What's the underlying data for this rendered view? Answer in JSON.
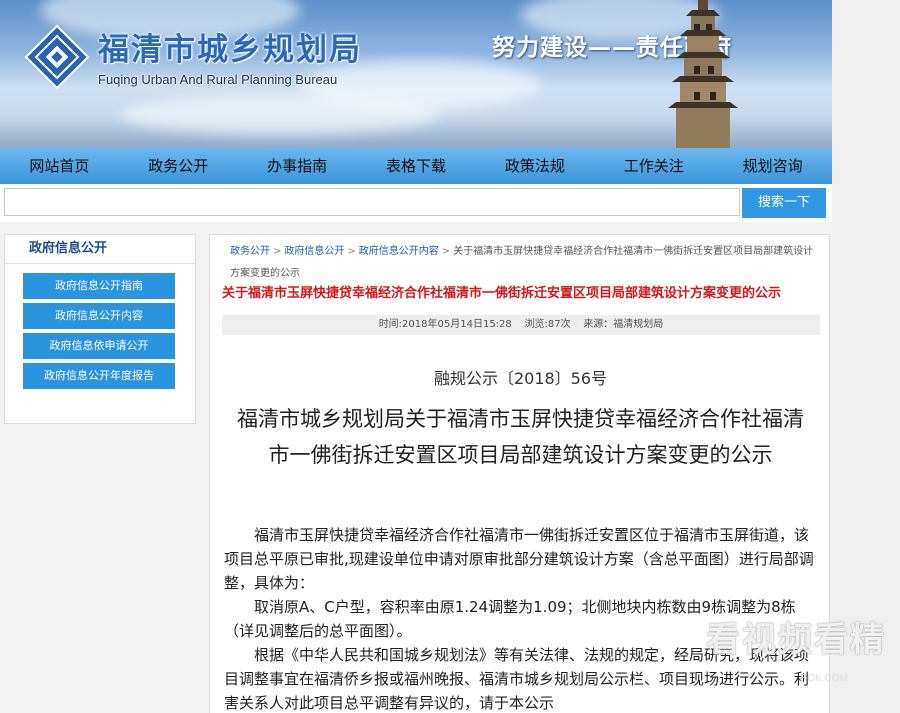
{
  "header": {
    "title_cn": "福清市城乡规划局",
    "title_en": "Fuqing Urban And Rural Planning Bureau",
    "slogan": "努力建设——责任政府"
  },
  "nav": {
    "items": [
      "网站首页",
      "政务公开",
      "办事指南",
      "表格下载",
      "政策法规",
      "工作关注",
      "规划咨询"
    ]
  },
  "search": {
    "button_label": "搜索一下",
    "placeholder": ""
  },
  "left_panel": {
    "heading": "政府信息公开",
    "items": [
      "政府信息公开指南",
      "政府信息公开内容",
      "政府信息依申请公开",
      "政府信息公开年度报告"
    ]
  },
  "breadcrumb": {
    "items": [
      "政务公开",
      "政府信息公开",
      "政府信息公开内容"
    ],
    "current": "关于福清市玉屏快捷贷幸福经济合作社福清市一佛街拆迁安置区项目局部建筑设计方案变更的公示"
  },
  "article": {
    "red_title": "关于福清市玉屏快捷贷幸福经济合作社福清市一佛街拆迁安置区项目局部建筑设计方案变更的公示",
    "meta_time": "时间:2018年05月14日15:28",
    "meta_views": "浏览:87次",
    "meta_source": "来源：福清规划局",
    "doc_no": "融规公示〔2018〕56号",
    "doc_title": "福清市城乡规划局关于福清市玉屏快捷贷幸福经济合作社福清市一佛街拆迁安置区项目局部建筑设计方案变更的公示",
    "paragraphs": [
      "福清市玉屏快捷贷幸福经济合作社福清市一佛街拆迁安置区位于福清市玉屏街道，该项目总平原已审批,现建设单位申请对原审批部分建筑设计方案（含总平面图）进行局部调整，具体为：",
      "取消原A、C户型，容积率由原1.24调整为1.09；北侧地块内栋数由9栋调整为8栋（详见调整后的总平面图）。",
      "根据《中华人民共和国城乡规划法》等有关法律、法规的规定，经局研究，现将该项目调整事宜在福清侨乡报或福州晚报、福清市城乡规划局公示栏、项目现场进行公示。利害关系人对此项目总平调整有异议的，请于本公示"
    ]
  },
  "watermark": {
    "text": "看视频看精",
    "sub": "ROK.COM"
  },
  "colors": {
    "nav_bg": "#3a93d8",
    "button_bg": "#2b94df",
    "title_red": "#d41818",
    "link_blue": "#1e5ea8"
  }
}
